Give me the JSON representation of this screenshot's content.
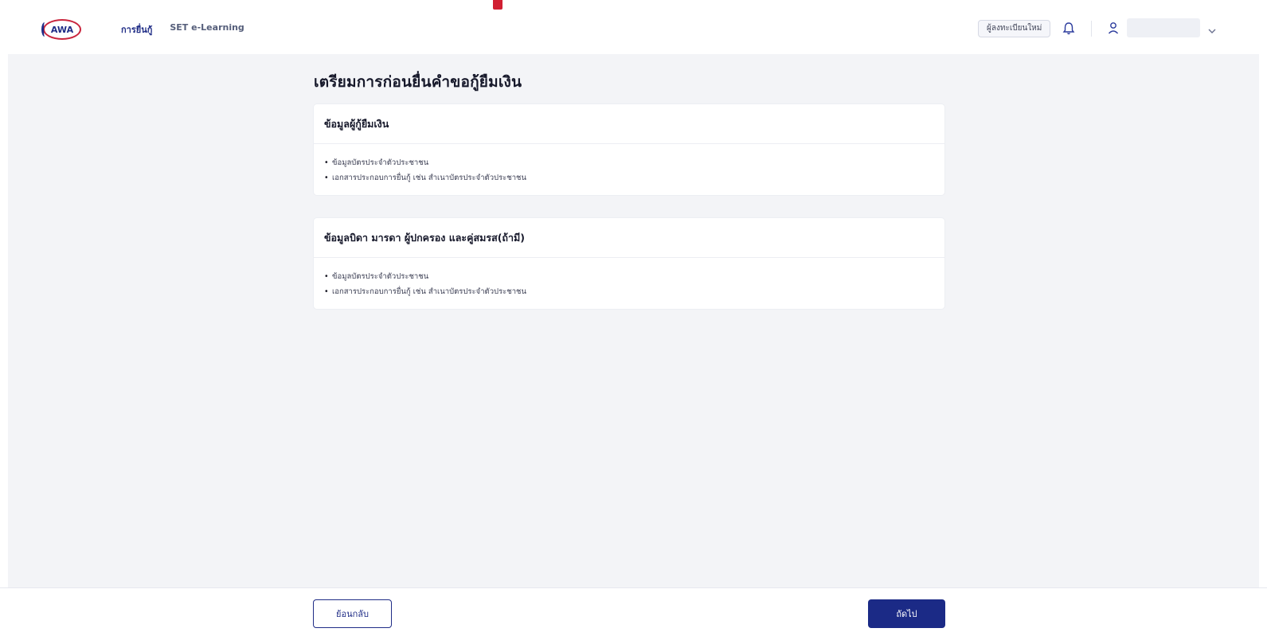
{
  "header": {
    "logo_text": "AWA",
    "nav": [
      {
        "label": "การยื่นกู้"
      },
      {
        "label": "SET e-Learning"
      }
    ],
    "new_register_label": "ผู้ลงทะเบียนใหม่",
    "bell_icon": "bell-icon",
    "user_icon": "user-icon",
    "chevron_icon": "chevron-down-icon"
  },
  "main": {
    "title": "เตรียมการก่อนยื่นคำขอกู้ยืมเงิน",
    "cards": [
      {
        "title": "ข้อมูลผู้กู้ยืมเงิน",
        "items": [
          "ข้อมูลบัตรประจำตัวประชาชน",
          "เอกสารประกอบการยื่นกู้ เช่น สำเนาบัตรประจำตัวประชาชน"
        ]
      },
      {
        "title": "ข้อมูลบิดา มารดา ผู้ปกครอง และคู่สมรส(ถ้ามี)",
        "items": [
          "ข้อมูลบัตรประจำตัวประชาชน",
          "เอกสารประกอบการยื่นกู้ เช่น สำเนาบัตรประจำตัวประชาชน"
        ]
      }
    ]
  },
  "footer": {
    "back_label": "ย้อนกลับ",
    "next_label": "ถัดไป"
  },
  "colors": {
    "primary": "#1b2a86",
    "accent_red": "#d11f32",
    "background": "#f3f4f7"
  }
}
